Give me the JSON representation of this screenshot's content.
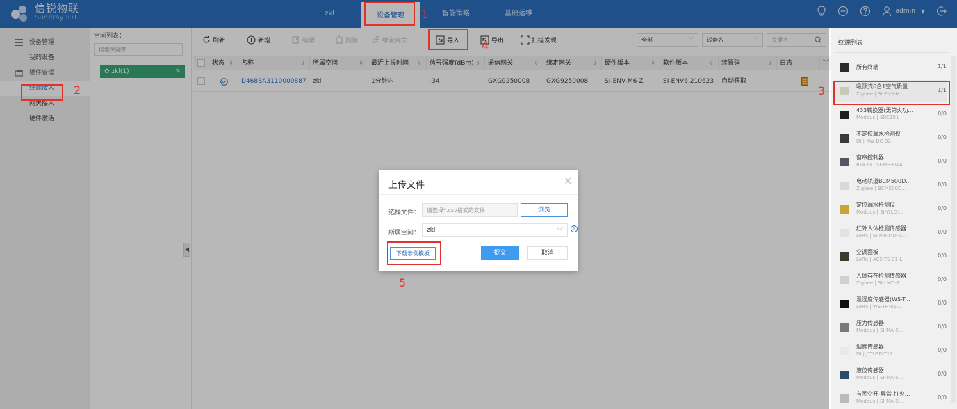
{
  "brand": {
    "name_cn": "信锐物联",
    "name_en": "Sundray IOT"
  },
  "topnav": {
    "items": [
      {
        "label": "zkl"
      },
      {
        "label": "设备管理"
      },
      {
        "label": "智能策略"
      },
      {
        "label": "基础运维"
      }
    ],
    "active_index": 1,
    "user": "admin"
  },
  "leftmenu": {
    "groups": [
      {
        "label": "设备管理",
        "items": [
          {
            "label": "我的设备"
          }
        ]
      },
      {
        "label": "硬件管理",
        "items": [
          {
            "label": "终端接入"
          },
          {
            "label": "网关接入"
          },
          {
            "label": "硬件激活"
          }
        ]
      }
    ],
    "active": "终端接入"
  },
  "space": {
    "title": "空间列表：",
    "search_placeholder": "搜索关键字",
    "node": "zkl(1)"
  },
  "toolbar": {
    "refresh": "刷新",
    "add": "新增",
    "edit": "编辑",
    "delete": "删除",
    "bind_gateway": "绑定网关",
    "import": "导入",
    "export": "导出",
    "scan": "扫描发现",
    "filter_all": "全部",
    "filter_field": "设备名",
    "search_placeholder": "关键字"
  },
  "table": {
    "headers": [
      "状态",
      "名称",
      "所属空间",
      "最近上报时间",
      "信号强度(dBm)",
      "通信网关",
      "绑定网关",
      "硬件版本",
      "软件版本",
      "装置码",
      "日志"
    ],
    "rows": [
      [
        "",
        "D468BA3110000887",
        "zkl",
        "1分钟内",
        "-34",
        "GXG9250008",
        "GXG9250008",
        "SI-ENV-M6-Z",
        "SI-ENV6.210623",
        "自动获取",
        ""
      ]
    ]
  },
  "dialog": {
    "title": "上传文件",
    "file_label": "选择文件：",
    "file_placeholder": "请选择*.csv格式的文件",
    "browse": "浏览",
    "space_label": "所属空间：",
    "space_value": "zkl",
    "download_template": "下载示例模板",
    "submit": "提交",
    "cancel": "取消"
  },
  "rightpanel": {
    "title": "终端列表",
    "items": [
      {
        "name": "所有终端",
        "sub": "",
        "count": "1/1",
        "thumb": "#2a2a2a"
      },
      {
        "name": "吸顶式6合1空气质量...",
        "sub": "Zigbee | SI-ENV-M...",
        "count": "1/1",
        "thumb": "#c9c9b8"
      },
      {
        "name": "433转换器(无第火功...",
        "sub": "Modbus | ERC101",
        "count": "0/0",
        "thumb": "#1e1e1e"
      },
      {
        "name": "不定位漏水检测仪",
        "sub": "DI | XW-DC-02",
        "count": "0/0",
        "thumb": "#3a3a3a"
      },
      {
        "name": "窗帘控制器",
        "sub": "RF433 | SI-ME-EWA...",
        "count": "0/0",
        "thumb": "#555566"
      },
      {
        "name": "电动轨道BCM500D...",
        "sub": "Zigbee | BCM500D...",
        "count": "0/0",
        "thumb": "#d8d8d8"
      },
      {
        "name": "定位漏水检测仪",
        "sub": "Modbus | SI-WLD-...",
        "count": "0/0",
        "thumb": "#c8a23a"
      },
      {
        "name": "红外人体检测传感器",
        "sub": "LoRa | SI-PIR-MD-0...",
        "count": "0/0",
        "thumb": "#e2e2e2"
      },
      {
        "name": "空调面板",
        "sub": "LoRa | ACS-TS-01-L",
        "count": "0/0",
        "thumb": "#3b3b30"
      },
      {
        "name": "人体存在检测传感器",
        "sub": "Zigbee | SI-LMD-Z",
        "count": "0/0",
        "thumb": "#cfcfcf"
      },
      {
        "name": "温湿度传感器(WS-T...",
        "sub": "LoRa | WS-TH-01-L",
        "count": "0/0",
        "thumb": "#111111"
      },
      {
        "name": "压力传感器",
        "sub": "Modbus | SI-MA-S...",
        "count": "0/0",
        "thumb": "#7a7a7a"
      },
      {
        "name": "烟雾传感器",
        "sub": "DI | JTY-GD-T12",
        "count": "0/0",
        "thumb": "#e9e9e9"
      },
      {
        "name": "液位传感器",
        "sub": "Modbus | SI-MA-S...",
        "count": "0/0",
        "thumb": "#2a4a6a"
      },
      {
        "name": "有图空开-异常-打火...",
        "sub": "Modbus | SI-MA-S...",
        "count": "0/0",
        "thumb": "#bbbbbb"
      }
    ]
  },
  "annotations": [
    "1",
    "2",
    "3",
    "4",
    "5"
  ],
  "colors": {
    "primary": "#2b6fc0",
    "accent_green": "#3aa776",
    "annotation_red": "#e3322c",
    "submit_blue": "#3d9cf0"
  }
}
